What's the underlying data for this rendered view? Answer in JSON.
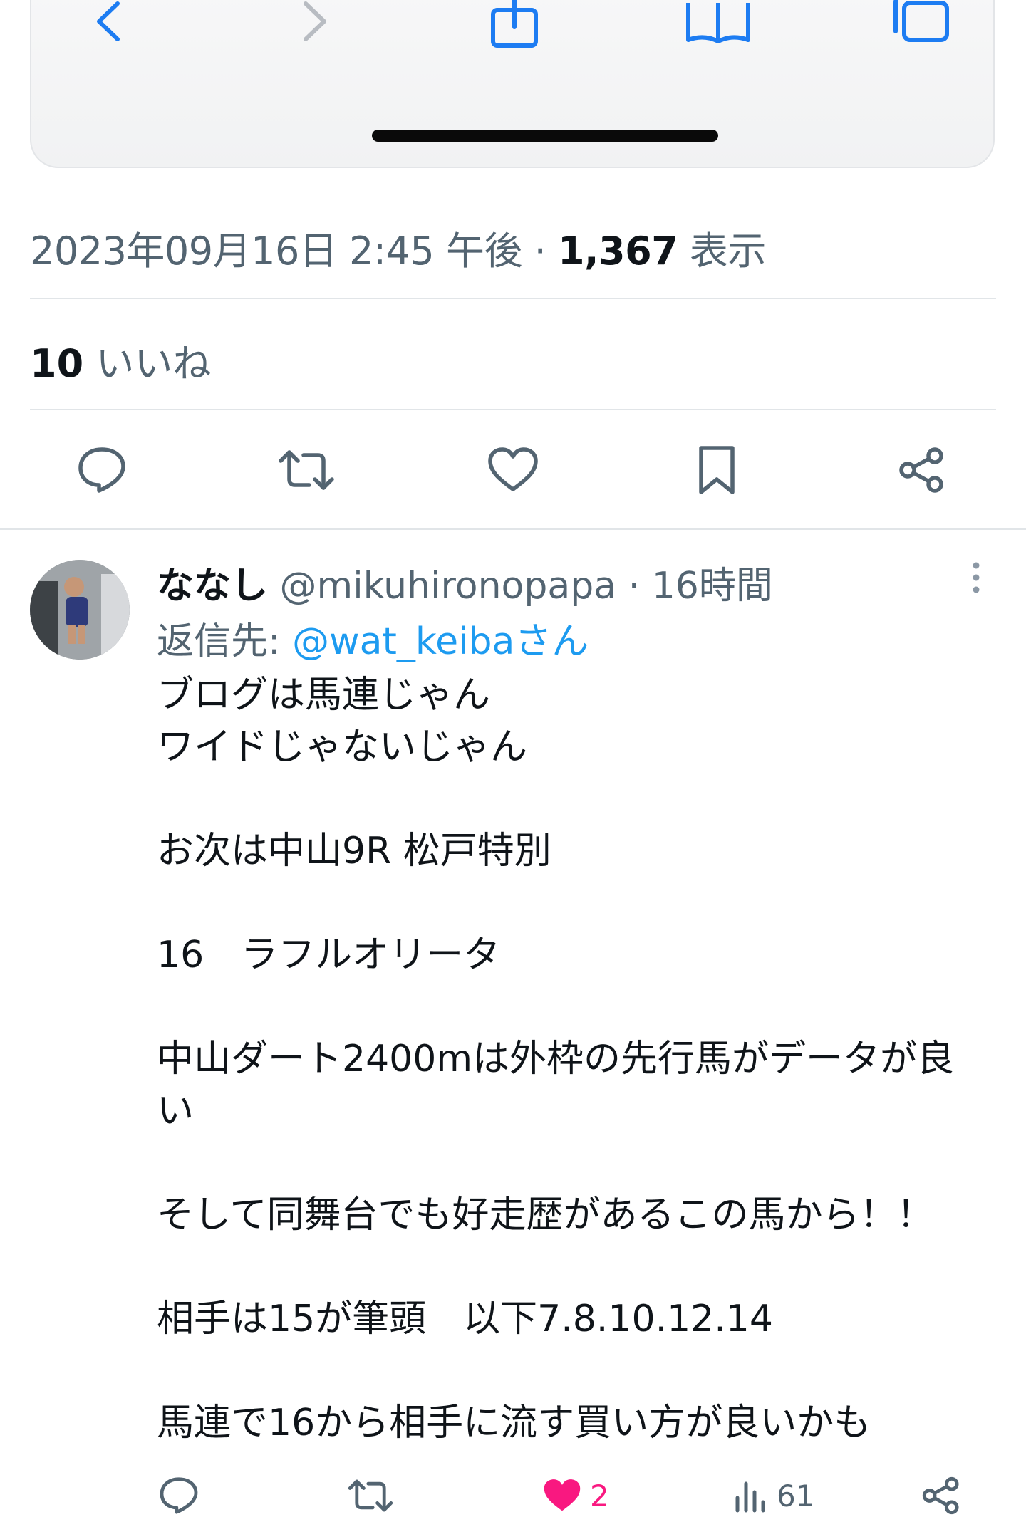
{
  "tweet": {
    "timestamp": "2023年09月16日 2:45 午後",
    "separator": "·",
    "views_count": "1,367",
    "views_label": "表示",
    "likes_count": "10",
    "likes_label": "いいね"
  },
  "reply": {
    "display_name": "ななし",
    "handle": "@mikuhironopapa",
    "time_ago": "16時間",
    "reply_to_prefix": "返信先:",
    "reply_to_handle": "@wat_keibaさん",
    "body": [
      "ブログは馬連じゃん",
      "ワイドじゃないじゃん",
      "",
      "お次は中山9R 松戸特別",
      "",
      "16　ラフルオリータ",
      "",
      "中山ダート2400mは外枠の先行馬がデータが良い",
      "",
      "そして同舞台でも好走歴があるこの馬から！！",
      "",
      "相手は15が筆頭　以下7.8.10.12.14",
      "",
      "馬連で16から相手に流す買い方が良いかも"
    ],
    "stats": {
      "likes": "2",
      "views": "61"
    }
  },
  "icons": {
    "browser_toolbar": [
      "back-icon",
      "forward-icon",
      "share-icon",
      "bookmarks-icon",
      "tabs-icon"
    ],
    "tweet_actions": [
      "reply-icon",
      "retweet-icon",
      "like-icon",
      "bookmark-icon",
      "share-icon"
    ]
  },
  "colors": {
    "accent": "#1d9bf0",
    "like": "#f91880",
    "secondary_text": "#536471",
    "text": "#0f1419"
  }
}
